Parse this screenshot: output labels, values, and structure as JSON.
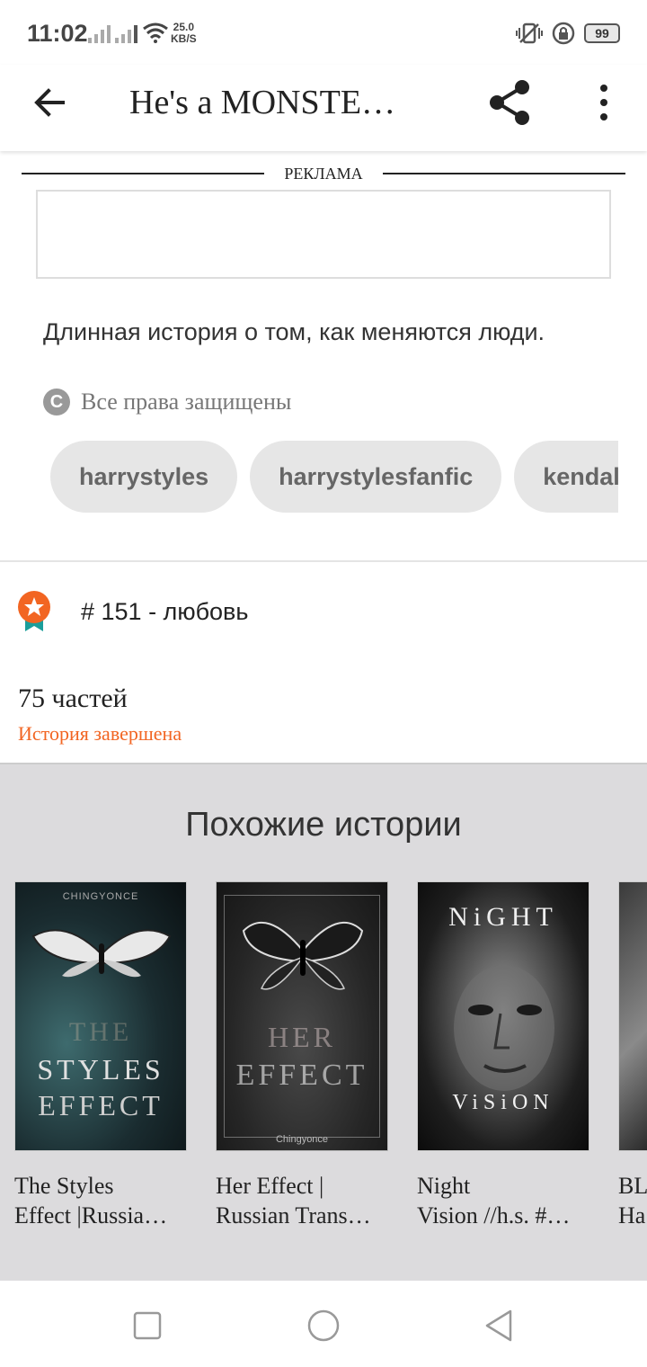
{
  "status_bar": {
    "time": "11:02",
    "speed_value": "25.0",
    "speed_unit": "KB/S",
    "battery": "99"
  },
  "app_bar": {
    "title": "He's a MONSTE…"
  },
  "ad": {
    "label": "РЕКЛАМА"
  },
  "story": {
    "description": "Длинная история о том, как меняются люди.",
    "copyright": "Все права защищены",
    "tags": [
      "harrystyles",
      "harrystylesfanfic",
      "kendalljenner"
    ],
    "rank": "# 151 - любовь",
    "parts": "75 частей",
    "status": "История завершена"
  },
  "similar": {
    "title": "Похожие истории",
    "books": [
      {
        "author_on_cover": "CHINGYONCE",
        "cover_lines": [
          "THE",
          "STYLES",
          "EFFECT"
        ],
        "title_line1": "The Styles",
        "title_line2": "Effect |Russia…"
      },
      {
        "author_on_cover": "Chingyonce",
        "cover_lines": [
          "HER",
          "EFFECT"
        ],
        "title_line1": "Her Effect |",
        "title_line2": "Russian Trans…"
      },
      {
        "cover_lines": [
          "NiGHT",
          "ViSiON"
        ],
        "title_line1": "Night",
        "title_line2": "Vision //h.s. #…"
      },
      {
        "title_line1": "BL",
        "title_line2": "Ha"
      }
    ]
  },
  "icons": [
    "back-arrow-icon",
    "share-icon",
    "more-vert-icon",
    "copyright-icon",
    "award-ribbon-icon",
    "recent-apps-icon",
    "home-icon",
    "back-triangle-icon"
  ]
}
